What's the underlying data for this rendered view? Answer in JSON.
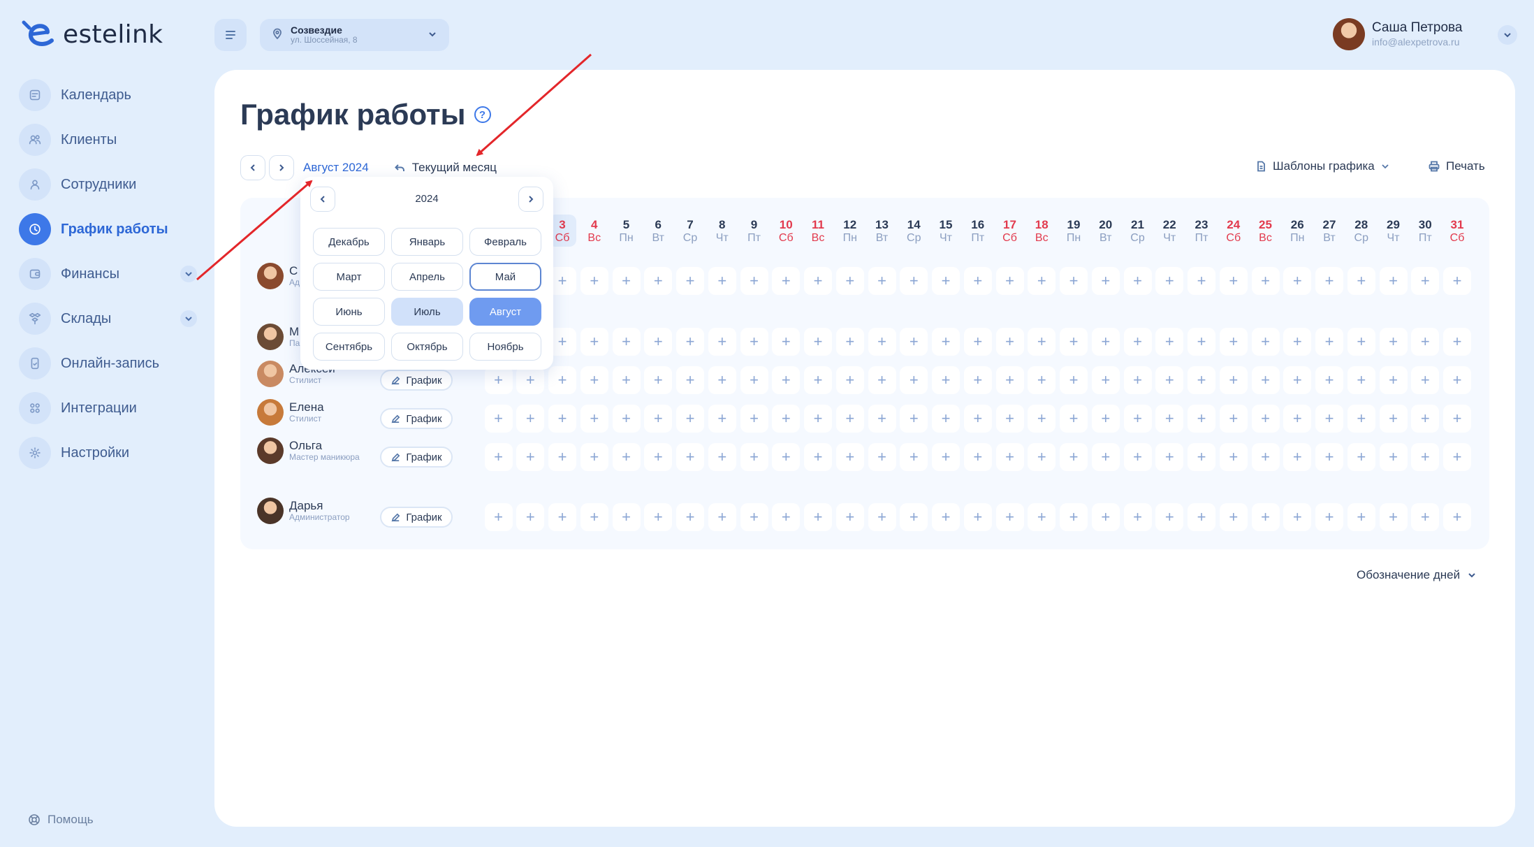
{
  "app": {
    "brand": "estelink"
  },
  "sidebar": {
    "items": [
      {
        "label": "Календарь",
        "icon": "calendar-icon"
      },
      {
        "label": "Клиенты",
        "icon": "clients-icon"
      },
      {
        "label": "Сотрудники",
        "icon": "user-icon"
      },
      {
        "label": "График работы",
        "icon": "clock-icon",
        "active": true
      },
      {
        "label": "Финансы",
        "icon": "wallet-icon",
        "expandable": true
      },
      {
        "label": "Склады",
        "icon": "boxes-icon",
        "expandable": true
      },
      {
        "label": "Онлайн-запись",
        "icon": "phone-icon"
      },
      {
        "label": "Интеграции",
        "icon": "grid-icon"
      },
      {
        "label": "Настройки",
        "icon": "gear-icon"
      }
    ],
    "help_label": "Помощь"
  },
  "topbar": {
    "location_name": "Созвездие",
    "location_address": "ул. Шоссейная, 8",
    "user_name": "Саша Петрова",
    "user_email": "info@alexpetrova.ru"
  },
  "page": {
    "title": "График работы",
    "help_mark": "?",
    "current_month": "Август 2024",
    "current_month_button": "Текущий месяц",
    "templates_label": "Шаблоны графика",
    "print_label": "Печать",
    "legend_label": "Обозначение дней",
    "schedule_button_label": "График",
    "add_symbol": "+"
  },
  "days": [
    {
      "n": "3",
      "w": "Сб",
      "weekend": true,
      "today": true
    },
    {
      "n": "4",
      "w": "Вс",
      "weekend": true
    },
    {
      "n": "5",
      "w": "Пн"
    },
    {
      "n": "6",
      "w": "Вт"
    },
    {
      "n": "7",
      "w": "Ср"
    },
    {
      "n": "8",
      "w": "Чт"
    },
    {
      "n": "9",
      "w": "Пт"
    },
    {
      "n": "10",
      "w": "Сб",
      "weekend": true
    },
    {
      "n": "11",
      "w": "Вс",
      "weekend": true
    },
    {
      "n": "12",
      "w": "Пн"
    },
    {
      "n": "13",
      "w": "Вт"
    },
    {
      "n": "14",
      "w": "Ср"
    },
    {
      "n": "15",
      "w": "Чт"
    },
    {
      "n": "16",
      "w": "Пт"
    },
    {
      "n": "17",
      "w": "Сб",
      "weekend": true
    },
    {
      "n": "18",
      "w": "Вс",
      "weekend": true
    },
    {
      "n": "19",
      "w": "Пн"
    },
    {
      "n": "20",
      "w": "Вт"
    },
    {
      "n": "21",
      "w": "Ср"
    },
    {
      "n": "22",
      "w": "Чт"
    },
    {
      "n": "23",
      "w": "Пт"
    },
    {
      "n": "24",
      "w": "Сб",
      "weekend": true
    },
    {
      "n": "25",
      "w": "Вс",
      "weekend": true
    },
    {
      "n": "26",
      "w": "Пн"
    },
    {
      "n": "27",
      "w": "Вт"
    },
    {
      "n": "28",
      "w": "Ср"
    },
    {
      "n": "29",
      "w": "Чт"
    },
    {
      "n": "30",
      "w": "Пт"
    },
    {
      "n": "31",
      "w": "Сб",
      "weekend": true
    }
  ],
  "employees": [
    {
      "name": "С",
      "role": "Ад",
      "hidden": true
    },
    {
      "name": "М",
      "role": "Па",
      "hidden": true
    },
    {
      "name": "Алексей",
      "role": "Стилист"
    },
    {
      "name": "Елена",
      "role": "Стилист"
    },
    {
      "name": "Ольга",
      "role": "Мастер маникюра"
    },
    {
      "name": "Дарья",
      "role": "Администратор"
    }
  ],
  "picker": {
    "year": "2024",
    "months": [
      "Декабрь",
      "Январь",
      "Февраль",
      "Март",
      "Апрель",
      "Май",
      "Июнь",
      "Июль",
      "Август",
      "Сентябрь",
      "Октябрь",
      "Ноябрь"
    ],
    "outlined": "Май",
    "highlighted": "Июль",
    "selected": "Август"
  },
  "colors": {
    "accent": "#3d78e8",
    "weekend": "#e23a4d",
    "background": "#e2eefc",
    "annotation_arrow": "#e3262a"
  }
}
